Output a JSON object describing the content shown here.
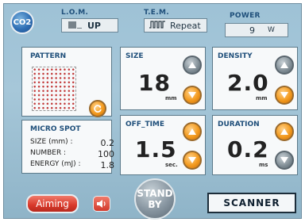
{
  "header": {
    "logo": "CO2",
    "lom": {
      "label": "L.O.M.",
      "value": "UP",
      "icon": "pulse-train-icon"
    },
    "tem": {
      "label": "T.E.M.",
      "value": "Repeat",
      "icon": "square-wave-icon"
    },
    "power": {
      "label": "POWER",
      "value": "9",
      "unit": "W"
    }
  },
  "pattern": {
    "label": "PATTERN",
    "grid": "10x10"
  },
  "micro_spot": {
    "title": "MICRO SPOT",
    "rows": [
      {
        "label": "SIZE (mm) :",
        "value": "0.2"
      },
      {
        "label": "NUMBER :",
        "value": "100"
      },
      {
        "label": "ENERGY (mJ) :",
        "value": "1.8"
      }
    ]
  },
  "size": {
    "label": "SIZE",
    "value": "18",
    "unit": "mm"
  },
  "density": {
    "label": "DENSITY",
    "value": "2.0",
    "unit": "mm"
  },
  "off_time": {
    "label": "OFF_TIME",
    "value": "1.5",
    "unit": "sec."
  },
  "duration": {
    "label": "DURATION",
    "value": "0.2",
    "unit": "ms"
  },
  "bottom": {
    "aiming": "Aiming",
    "standby_line1": "STAND",
    "standby_line2": "BY",
    "scanner": "SCANNER"
  },
  "colors": {
    "background": "#a6c7d9",
    "accent_orange": "#f39a1e",
    "aiming_red": "#d8382a",
    "label_blue": "#1f4f7a"
  }
}
